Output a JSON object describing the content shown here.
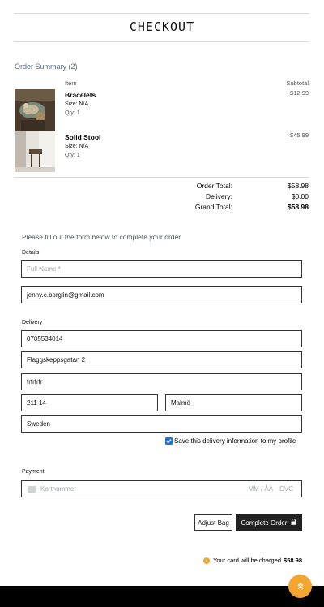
{
  "header": {
    "title": "CHECKOUT"
  },
  "summary": {
    "label": "Order Summary (2)",
    "col_item": "Item",
    "col_subtotal": "Subtotal",
    "items": [
      {
        "name": "Bracelets",
        "size": "Size: N/A",
        "qty": "Qty: 1",
        "price": "$12.99"
      },
      {
        "name": "Solid Stool",
        "size": "Size: N/A",
        "qty": "Qty: 1",
        "price": "$45.99"
      }
    ],
    "totals": {
      "order_total_label": "Order Total:",
      "order_total": "$58.98",
      "delivery_label": "Delivery:",
      "delivery": "$0.00",
      "grand_total_label": "Grand Total:",
      "grand_total": "$58.98"
    }
  },
  "form": {
    "intro": "Please fill out the form below to complete your order",
    "details_label": "Details",
    "full_name_placeholder": "Full Name *",
    "email": "jenny.c.borglin@gmail.com",
    "delivery_label": "Delivery",
    "phone": "0705534014",
    "street1": "Flaggskeppsgatan 2",
    "street2": "frfrfrfr",
    "postcode": "211 14",
    "town": "Malmö",
    "country": "Sweden",
    "save_label": "Save this delivery information to my profile",
    "save_checked": true,
    "payment_label": "Payment",
    "card_placeholder": "Kortnummer",
    "expiry_placeholder": "MM / ÅÅ",
    "cvc_placeholder": "CVC"
  },
  "actions": {
    "adjust_label": "Adjust Bag",
    "complete_label": "Complete Order"
  },
  "charge": {
    "text": "Your card will be charged",
    "amount": "$58.98"
  },
  "colors": {
    "accent": "#f2a531",
    "checkbox": "#1a73e8",
    "dark_button": "#222222"
  }
}
